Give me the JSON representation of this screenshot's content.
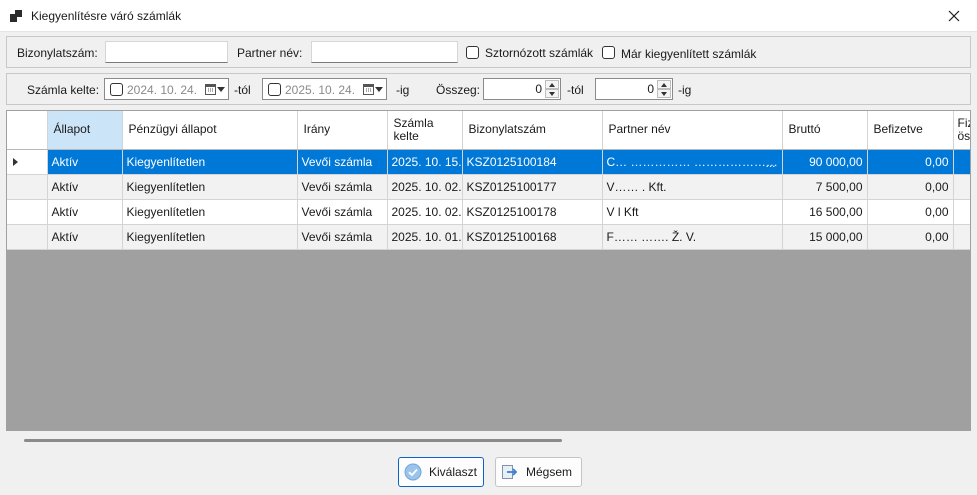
{
  "window": {
    "title": "Kiegyenlítésre váró számlák"
  },
  "filters": {
    "document_no_label": "Bizonylatszám:",
    "document_no_value": "",
    "partner_label": "Partner név:",
    "partner_value": "",
    "cancelled_label": "Sztornózott számlák",
    "settled_label": "Már kiegyenlített számlák",
    "invoice_date_label": "Számla kelte:",
    "date_from": "2024. 10. 24.",
    "from_suffix": "-tól",
    "date_to": "2025. 10. 24.",
    "to_suffix": "-ig",
    "amount_label": "Összeg:",
    "amount_from": "0",
    "amount_from_suffix": "-tól",
    "amount_to": "0",
    "amount_to_suffix": "-ig"
  },
  "grid": {
    "columns": [
      "Állapot",
      "Pénzügyi állapot",
      "Irány",
      "Számla kelte",
      "Bizonylatszám",
      "Partner név",
      "Bruttó",
      "Befizetve",
      "Fiz. öss"
    ],
    "column_lines": {
      "invoice_date_1": "Számla",
      "invoice_date_2": "kelte",
      "last_1": "Fiz",
      "last_2": "ös"
    },
    "rows": [
      {
        "status": "Aktív",
        "financial": "Kiegyenlítetlen",
        "direction": "Vevői számla",
        "date": "2025. 10. 15.",
        "doc": "KSZ0125100184",
        "partner": "C… …………… …………………",
        "gross": "90 000,00",
        "paid": "0,00"
      },
      {
        "status": "Aktív",
        "financial": "Kiegyenlítetlen",
        "direction": "Vevői számla",
        "date": "2025. 10. 02.",
        "doc": "KSZ0125100177",
        "partner": "V…… . Kft.",
        "gross": "7 500,00",
        "paid": "0,00"
      },
      {
        "status": "Aktív",
        "financial": "Kiegyenlítetlen",
        "direction": "Vevői számla",
        "date": "2025. 10. 02.",
        "doc": "KSZ0125100178",
        "partner": "V         l Kft",
        "gross": "16 500,00",
        "paid": "0,00"
      },
      {
        "status": "Aktív",
        "financial": "Kiegyenlítetlen",
        "direction": "Vevői számla",
        "date": "2025. 10. 01.",
        "doc": "KSZ0125100168",
        "partner": "F…… ……. Ž. V.",
        "gross": "15 000,00",
        "paid": "0,00"
      }
    ],
    "ellipsis": "..."
  },
  "buttons": {
    "select_label": "Kiválaszt",
    "cancel_label": "Mégsem"
  },
  "colors": {
    "selection": "#0078d7",
    "header_selected": "#cce4f7",
    "primary_border": "#0a64c8"
  },
  "icons": {
    "app": "app-window-icon",
    "close": "close-icon",
    "select": "check-circle-icon",
    "cancel": "exit-arrow-icon",
    "calendar": "calendar-icon"
  }
}
